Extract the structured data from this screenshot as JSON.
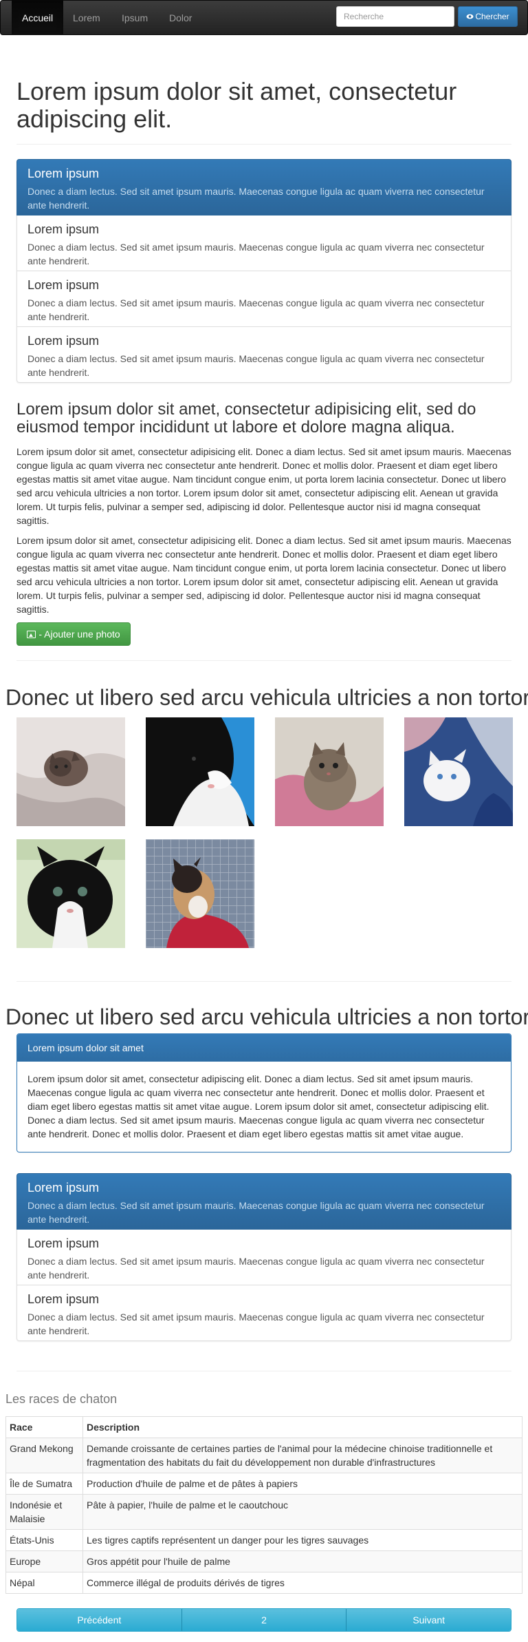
{
  "navbar": {
    "items": [
      {
        "label": "Accueil",
        "active": true
      },
      {
        "label": "Lorem",
        "active": false
      },
      {
        "label": "Ipsum",
        "active": false
      },
      {
        "label": "Dolor",
        "active": false
      }
    ],
    "search_placeholder": "Recherche",
    "search_button": "Chercher"
  },
  "hero_title": "Lorem ipsum dolor sit amet, consectetur adipiscing elit.",
  "list1": [
    {
      "heading": "Lorem ipsum",
      "text": "Donec a diam lectus. Sed sit amet ipsum mauris. Maecenas congue ligula ac quam viverra nec consectetur ante hendrerit.",
      "active": true
    },
    {
      "heading": "Lorem ipsum",
      "text": "Donec a diam lectus. Sed sit amet ipsum mauris. Maecenas congue ligula ac quam viverra nec consectetur ante hendrerit.",
      "active": false
    },
    {
      "heading": "Lorem ipsum",
      "text": "Donec a diam lectus. Sed sit amet ipsum mauris. Maecenas congue ligula ac quam viverra nec consectetur ante hendrerit.",
      "active": false
    },
    {
      "heading": "Lorem ipsum",
      "text": "Donec a diam lectus. Sed sit amet ipsum mauris. Maecenas congue ligula ac quam viverra nec consectetur ante hendrerit.",
      "active": false
    }
  ],
  "section_title": "Lorem ipsum dolor sit amet, consectetur adipisicing elit, sed do eiusmod tempor incididunt ut labore et dolore magna aliqua.",
  "paragraphs": [
    "Lorem ipsum dolor sit amet, consectetur adipisicing elit. Donec a diam lectus. Sed sit amet ipsum mauris. Maecenas congue ligula ac quam viverra nec consectetur ante hendrerit. Donec et mollis dolor. Praesent et diam eget libero egestas mattis sit amet vitae augue. Nam tincidunt congue enim, ut porta lorem lacinia consectetur. Donec ut libero sed arcu vehicula ultricies a non tortor. Lorem ipsum dolor sit amet, consectetur adipiscing elit. Aenean ut gravida lorem. Ut turpis felis, pulvinar a semper sed, adipiscing id dolor. Pellentesque auctor nisi id magna consequat sagittis.",
    "Lorem ipsum dolor sit amet, consectetur adipisicing elit. Donec a diam lectus. Sed sit amet ipsum mauris. Maecenas congue ligula ac quam viverra nec consectetur ante hendrerit. Donec et mollis dolor. Praesent et diam eget libero egestas mattis sit amet vitae augue. Nam tincidunt congue enim, ut porta lorem lacinia consectetur. Donec ut libero sed arcu vehicula ultricies a non tortor. Lorem ipsum dolor sit amet, consectetur adipiscing elit. Aenean ut gravida lorem. Ut turpis felis, pulvinar a semper sed, adipiscing id dolor. Pellentesque auctor nisi id magna consequat sagittis."
  ],
  "photo_button": "- Ajouter une photo",
  "gallery_title": "Donec ut libero sed arcu vehicula ultricies a non tortor :",
  "gallery_icons": [
    "kitten-photo-1",
    "kitten-photo-2",
    "kitten-photo-3",
    "kitten-photo-4",
    "kitten-photo-5",
    "kitten-photo-6"
  ],
  "section2_title": "Donec ut libero sed arcu vehicula ultricies a non tortor :",
  "panel": {
    "heading": "Lorem ipsum dolor sit amet",
    "body": "Lorem ipsum dolor sit amet, consectetur adipiscing elit. Donec a diam lectus. Sed sit amet ipsum mauris. Maecenas congue ligula ac quam viverra nec consectetur ante hendrerit. Donec et mollis dolor. Praesent et diam eget libero egestas mattis sit amet vitae augue. Lorem ipsum dolor sit amet, consectetur adipiscing elit. Donec a diam lectus. Sed sit amet ipsum mauris. Maecenas congue ligula ac quam viverra nec consectetur ante hendrerit. Donec et mollis dolor. Praesent et diam eget libero egestas mattis sit amet vitae augue."
  },
  "list2": [
    {
      "heading": "Lorem ipsum",
      "text": "Donec a diam lectus. Sed sit amet ipsum mauris. Maecenas congue ligula ac quam viverra nec consectetur ante hendrerit.",
      "active": true
    },
    {
      "heading": "Lorem ipsum",
      "text": "Donec a diam lectus. Sed sit amet ipsum mauris. Maecenas congue ligula ac quam viverra nec consectetur ante hendrerit.",
      "active": false
    },
    {
      "heading": "Lorem ipsum",
      "text": "Donec a diam lectus. Sed sit amet ipsum mauris. Maecenas congue ligula ac quam viverra nec consectetur ante hendrerit.",
      "active": false
    }
  ],
  "table": {
    "title": "Les races de chaton",
    "headers": [
      "Race",
      "Description"
    ],
    "rows": [
      [
        "Grand Mekong",
        "Demande croissante de certaines parties de l'animal pour la médecine chinoise traditionnelle et fragmentation des habitats du fait du développement non durable d'infrastructures"
      ],
      [
        "Île de Sumatra",
        "Production d'huile de palme et de pâtes à papiers"
      ],
      [
        "Indonésie et Malaisie",
        "Pâte à papier, l'huile de palme et le caoutchouc"
      ],
      [
        "États-Unis",
        "Les tigres captifs représentent un danger pour les tigres sauvages"
      ],
      [
        "Europe",
        "Gros appétit pour l'huile de palme"
      ],
      [
        "Népal",
        "Commerce illégal de produits dérivés de tigres"
      ]
    ]
  },
  "pager": {
    "prev": "Précédent",
    "page": "2",
    "next": "Suivant"
  },
  "colors": {
    "primary": "#337ab7",
    "success": "#5cb85c",
    "info": "#5bc0de",
    "navbar": "#222222"
  }
}
